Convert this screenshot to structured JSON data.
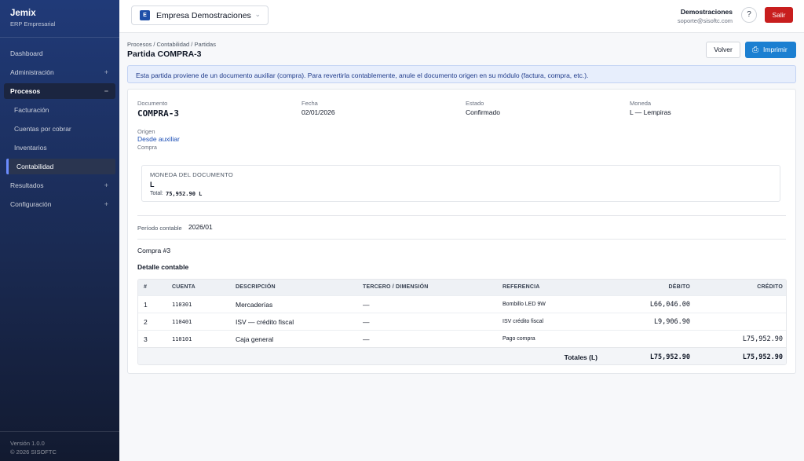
{
  "sidebar": {
    "brand": "Jemix",
    "brand_sub": "ERP Empresarial",
    "items": [
      {
        "label": "Dashboard"
      },
      {
        "label": "Administración",
        "toggle": "+"
      },
      {
        "label": "Procesos",
        "toggle": "−"
      },
      {
        "label": "Facturación"
      },
      {
        "label": "Cuentas por cobrar"
      },
      {
        "label": "Inventarios"
      },
      {
        "label": "Contabilidad"
      },
      {
        "label": "Resultados",
        "toggle": "+"
      },
      {
        "label": "Configuración",
        "toggle": "+"
      }
    ],
    "version": "Versión 1.0.0",
    "copyright": "© 2026 SISOFTC"
  },
  "header": {
    "company_badge": "E",
    "company_name": "Empresa Demostraciones",
    "user_name": "Demostraciones",
    "user_email": "soporte@sisoftc.com",
    "help_icon": "?",
    "logout_label": "Salir"
  },
  "page": {
    "breadcrumb": "Procesos / Contabilidad / Partidas",
    "title": "Partida COMPRA-3",
    "back_label": "Volver",
    "print_label": "Imprimir",
    "notice": "Esta partida proviene de un documento auxiliar (compra). Para revertirla contablemente, anule el documento origen en su módulo (factura, compra, etc.)."
  },
  "summary": {
    "documento_label": "Documento",
    "documento_value": "COMPRA-3",
    "fecha_label": "Fecha",
    "fecha_value": "02/01/2026",
    "estado_label": "Estado",
    "estado_value": "Confirmado",
    "moneda_label": "Moneda",
    "moneda_value": "L — Lempiras",
    "origen_label": "Origen",
    "origen_value": "Desde auxiliar",
    "origen_sub": "Compra"
  },
  "currency_box": {
    "label": "MONEDA DEL DOCUMENTO",
    "symbol": "L",
    "total_label": "Total:",
    "total_value": "75,952.90 L"
  },
  "period": {
    "label": "Período contable",
    "value": "2026/01"
  },
  "compra_ref": "Compra #3",
  "detail_title": "Detalle contable",
  "table": {
    "headers": [
      "#",
      "CUENTA",
      "DESCRIPCIÓN",
      "TERCERO / DIMENSIÓN",
      "REFERENCIA",
      "DÉBITO",
      "CRÉDITO"
    ],
    "rows": [
      {
        "num": "1",
        "cuenta": "110301",
        "descripcion": "Mercaderías",
        "tercero": "—",
        "referencia": "Bombillo LED 9W",
        "debito": "L66,046.00",
        "credito": ""
      },
      {
        "num": "2",
        "cuenta": "110401",
        "descripcion": "ISV — crédito fiscal",
        "tercero": "—",
        "referencia": "ISV crédito fiscal",
        "debito": "L9,906.90",
        "credito": ""
      },
      {
        "num": "3",
        "cuenta": "110101",
        "descripcion": "Caja general",
        "tercero": "—",
        "referencia": "Pago compra",
        "debito": "",
        "credito": "L75,952.90"
      }
    ],
    "totals_label": "Totales (L)",
    "total_debito": "L75,952.90",
    "total_credito": "L75,952.90"
  }
}
